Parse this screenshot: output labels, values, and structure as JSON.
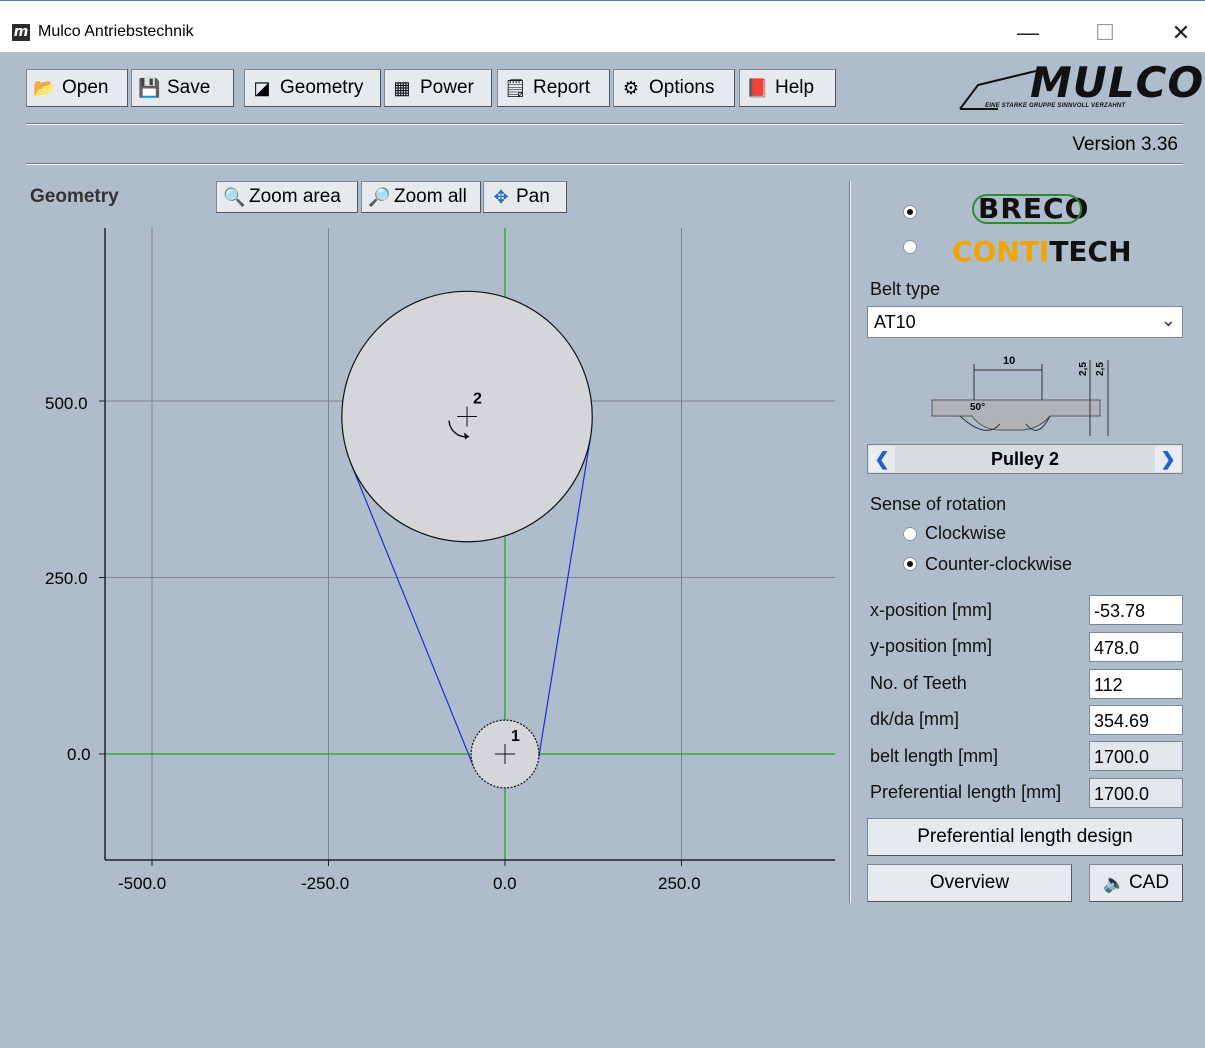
{
  "window": {
    "icon_letter": "m",
    "title": "Mulco Antriebstechnik",
    "minimize_glyph": "—",
    "maximize_glyph": "☐",
    "close_glyph": "✕"
  },
  "toolbar": [
    {
      "label": "Open",
      "icon": "folder-icon"
    },
    {
      "label": "Save",
      "icon": "floppy-icon"
    },
    {
      "label": "Geometry",
      "icon": "geometry-icon"
    },
    {
      "label": "Power",
      "icon": "calculator-icon"
    },
    {
      "label": "Report",
      "icon": "report-icon"
    },
    {
      "label": "Options",
      "icon": "options-icon"
    },
    {
      "label": "Help",
      "icon": "help-book-icon"
    }
  ],
  "logo": {
    "text": "MULCO",
    "tagline": "EINE STARKE GRUPPE SINNVOLL VERZAHNT"
  },
  "version": "Version 3.36",
  "geometry": {
    "title": "Geometry",
    "zoom_area": "Zoom area",
    "zoom_all": "Zoom all",
    "pan": "Pan"
  },
  "plot": {
    "x_ticks": [
      "-500.0",
      "-250.0",
      "0.0",
      "250.0"
    ],
    "y_ticks": [
      "500.0",
      "250.0",
      "0.0"
    ],
    "pulleys": [
      {
        "label": "1",
        "x": 0,
        "y": 0,
        "dk": 96
      },
      {
        "label": "2",
        "x": -53.78,
        "y": 478.0,
        "dk": 354.69
      }
    ],
    "colors": {
      "axis_zero": "#1cab1c",
      "belt": "#1f2ed1",
      "grid": "#7d858f",
      "pulley_fill": "#d4d6d9"
    }
  },
  "panel": {
    "brand_breco": "BRECO",
    "brand_contitech_a": "CONTI",
    "brand_contitech_b": "TECH",
    "belt_type_label": "Belt type",
    "belt_type_value": "AT10",
    "profile_dims": {
      "pitch": "10",
      "h1": "2,5",
      "h2": "2,5",
      "angle": "50°"
    },
    "pulley_title": "Pulley 2",
    "rotation_label": "Sense of rotation",
    "clockwise": "Clockwise",
    "counter_clockwise": "Counter-clockwise",
    "rows": [
      {
        "label": "x-position [mm]",
        "value": "-53.78",
        "readonly": false
      },
      {
        "label": "y-position [mm]",
        "value": "478.0",
        "readonly": false
      },
      {
        "label": "No. of Teeth",
        "value": "112",
        "readonly": false
      },
      {
        "label": "dk/da [mm]",
        "value": "354.69",
        "readonly": false
      },
      {
        "label": "belt length [mm]",
        "value": "1700.0",
        "readonly": true
      },
      {
        "label": "Preferential length [mm]",
        "value": "1700.0",
        "readonly": true
      }
    ],
    "pref_button": "Preferential length design",
    "overview_button": "Overview",
    "cad_button": "CAD"
  }
}
